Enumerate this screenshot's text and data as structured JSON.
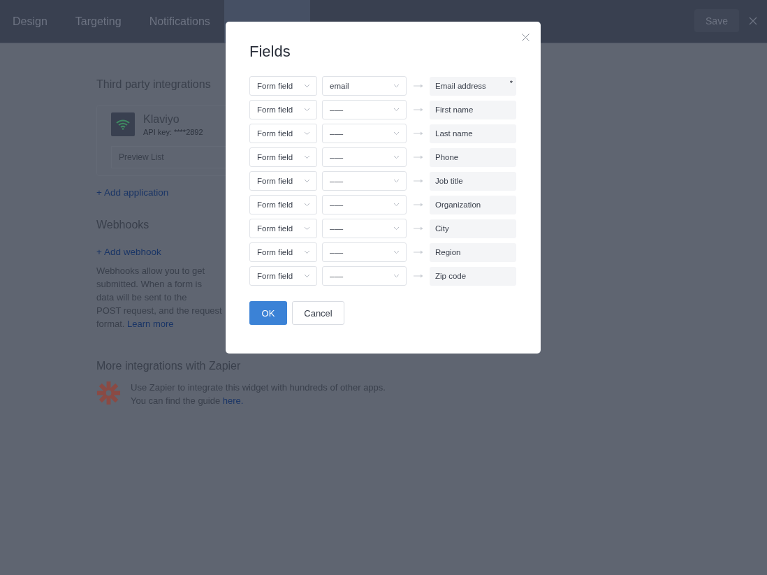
{
  "tabs": [
    {
      "label": "Design",
      "selected": false
    },
    {
      "label": "Targeting",
      "selected": false
    },
    {
      "label": "Notifications",
      "selected": false
    },
    {
      "selected": true
    }
  ],
  "save_button": "Save",
  "third_party": {
    "title": "Third party integrations",
    "app": {
      "name": "Klaviyo",
      "api_key": "API key: ****2892",
      "preview": "Preview List"
    },
    "add": "+ Add application"
  },
  "webhooks": {
    "title": "Webhooks",
    "add": "+ Add webhook",
    "description": [
      "Webhooks allow you to get",
      "submitted. When a form is",
      "data will be sent to the",
      "POST request, and the request",
      "format. "
    ],
    "link": "Learn more"
  },
  "zapier": {
    "title": "More integrations with Zapier",
    "text": [
      "Use Zapier to integrate this widget with hundreds of other apps.",
      "You can find the guide "
    ],
    "link": "here."
  },
  "dialog": {
    "title": "Fields",
    "rows": [
      {
        "source": "Form field",
        "field": "email",
        "target": "Email address",
        "required": true
      },
      {
        "source": "Form field",
        "field": "–––",
        "target": "First name",
        "required": false
      },
      {
        "source": "Form field",
        "field": "–––",
        "target": "Last name",
        "required": false
      },
      {
        "source": "Form field",
        "field": "–––",
        "target": "Phone",
        "required": false
      },
      {
        "source": "Form field",
        "field": "–––",
        "target": "Job title",
        "required": false
      },
      {
        "source": "Form field",
        "field": "–––",
        "target": "Organization",
        "required": false
      },
      {
        "source": "Form field",
        "field": "–––",
        "target": "City",
        "required": false
      },
      {
        "source": "Form field",
        "field": "–––",
        "target": "Region",
        "required": false
      },
      {
        "source": "Form field",
        "field": "–––",
        "target": "Zip code",
        "required": false
      }
    ],
    "required_mark": "*",
    "ok": "OK",
    "cancel": "Cancel"
  }
}
